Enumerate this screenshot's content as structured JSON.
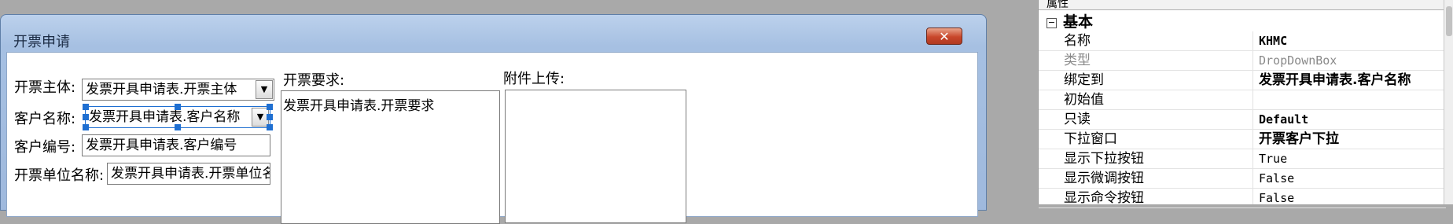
{
  "dialog": {
    "title": "开票申请",
    "close_label": "✕"
  },
  "form": {
    "subject_label": "开票主体:",
    "subject_value": "发票开具申请表.开票主体",
    "customer_name_label": "客户名称:",
    "customer_name_value": "发票开具申请表.客户名称",
    "customer_code_label": "客户编号:",
    "customer_code_value": "发票开具申请表.客户编号",
    "unit_name_label": "开票单位名称:",
    "unit_name_value": "发票开具申请表.开票单位名称",
    "requirement_label": "开票要求:",
    "requirement_value": "发票开具申请表.开票要求",
    "attachment_label": "附件上传:"
  },
  "properties": {
    "header": "属性",
    "category": "基本",
    "rows": [
      {
        "name": "名称",
        "value": "KHMC"
      },
      {
        "name": "类型",
        "value": "DropDownBox"
      },
      {
        "name": "绑定到",
        "value": "发票开具申请表.客户名称"
      },
      {
        "name": "初始值",
        "value": ""
      },
      {
        "name": "只读",
        "value": "Default"
      },
      {
        "name": "下拉窗口",
        "value": "开票客户下拉"
      },
      {
        "name": "显示下拉按钮",
        "value": "True"
      },
      {
        "name": "显示微调按钮",
        "value": "False"
      },
      {
        "name": "显示命令按钮",
        "value": "False"
      }
    ]
  }
}
